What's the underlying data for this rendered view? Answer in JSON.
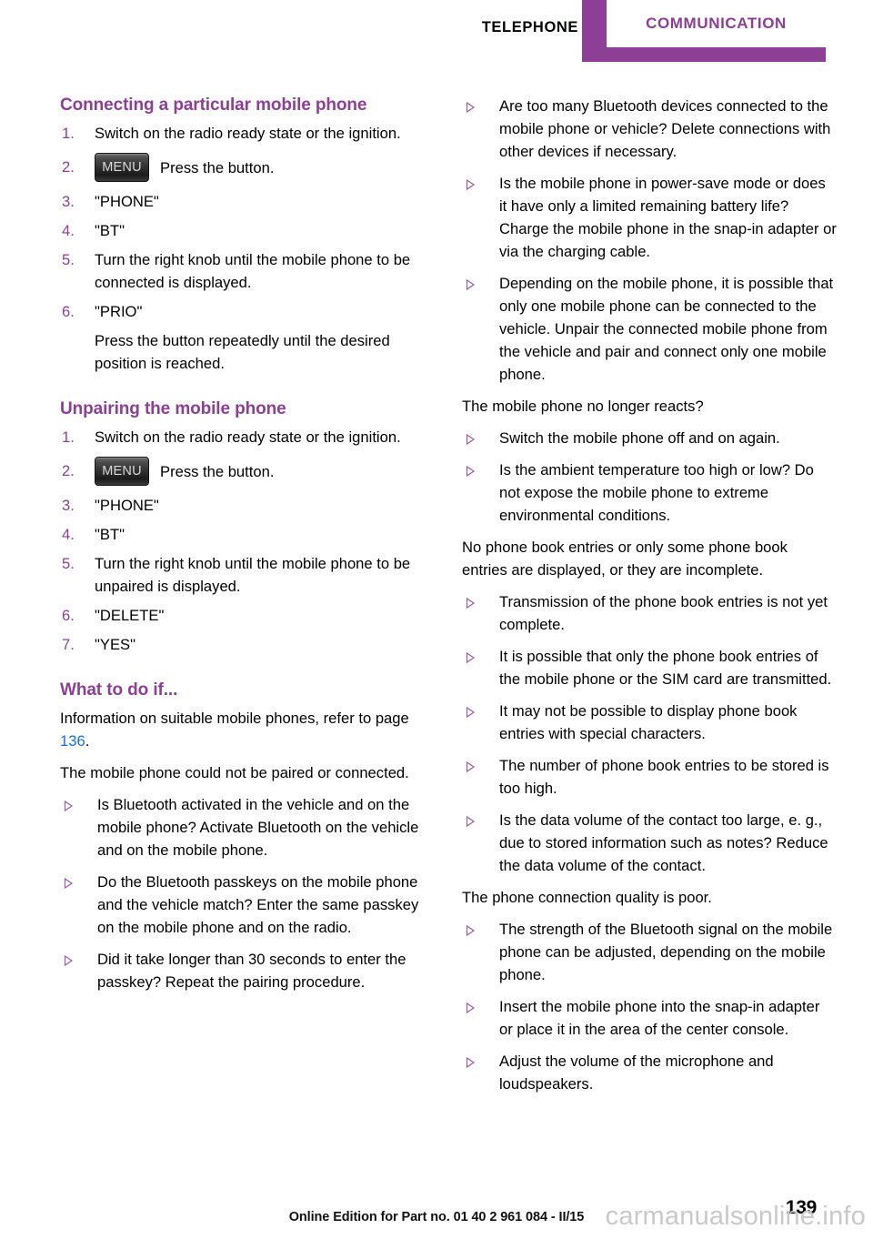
{
  "header": {
    "chapter_label": "TELEPHONE",
    "tab_label": "COMMUNICATION",
    "accent_color": "#8c3f95"
  },
  "icons": {
    "menu_key_label": "MENU",
    "bullet_icon": "triangle-right-icon"
  },
  "left_column": {
    "section1": {
      "heading": "Connecting a particular mobile phone",
      "steps": [
        {
          "num": "1.",
          "text": "Switch on the radio ready state or the ignition."
        },
        {
          "num": "2.",
          "key": "MENU",
          "text": "Press the button."
        },
        {
          "num": "3.",
          "text": "\"PHONE\""
        },
        {
          "num": "4.",
          "text": "\"BT\""
        },
        {
          "num": "5.",
          "text": "Turn the right knob until the mobile phone to be connected is displayed."
        },
        {
          "num": "6.",
          "text": "\"PRIO\""
        }
      ],
      "step6_note": "Press the button repeatedly until the desired position is reached."
    },
    "section2": {
      "heading": "Unpairing the mobile phone",
      "steps": [
        {
          "num": "1.",
          "text": "Switch on the radio ready state or the ignition."
        },
        {
          "num": "2.",
          "key": "MENU",
          "text": "Press the button."
        },
        {
          "num": "3.",
          "text": "\"PHONE\""
        },
        {
          "num": "4.",
          "text": "\"BT\""
        },
        {
          "num": "5.",
          "text": "Turn the right knob until the mobile phone to be unpaired is displayed."
        },
        {
          "num": "6.",
          "text": "\"DELETE\""
        },
        {
          "num": "7.",
          "text": "\"YES\""
        }
      ]
    },
    "section3": {
      "heading": "What to do if...",
      "intro_before_ref": "Information on suitable mobile phones, refer to page ",
      "intro_page_ref": "136",
      "intro_after_ref": ".",
      "problem1": "The mobile phone could not be paired or connected.",
      "bullets1": [
        "Is Bluetooth activated in the vehicle and on the mobile phone? Activate Bluetooth on the vehicle and on the mobile phone.",
        "Do the Bluetooth passkeys on the mobile phone and the vehicle match? Enter the same passkey on the mobile phone and on the radio.",
        "Did it take longer than 30 seconds to enter the passkey? Repeat the pairing procedure."
      ]
    }
  },
  "right_column": {
    "bullets_continued": [
      "Are too many Bluetooth devices connected to the mobile phone or vehicle? Delete connections with other devices if necessary.",
      "Is the mobile phone in power-save mode or does it have only a limited remaining battery life? Charge the mobile phone in the snap-in adapter or via the charging cable.",
      "Depending on the mobile phone, it is possible that only one mobile phone can be connected to the vehicle. Unpair the connected mobile phone from the vehicle and pair and connect only one mobile phone."
    ],
    "problem2": "The mobile phone no longer reacts?",
    "bullets2": [
      "Switch the mobile phone off and on again.",
      "Is the ambient temperature too high or low? Do not expose the mobile phone to extreme environmental conditions."
    ],
    "problem3": "No phone book entries or only some phone book entries are displayed, or they are incomplete.",
    "bullets3": [
      "Transmission of the phone book entries is not yet complete.",
      "It is possible that only the phone book entries of the mobile phone or the SIM card are transmitted.",
      "It may not be possible to display phone book entries with special characters.",
      "The number of phone book entries to be stored is too high.",
      "Is the data volume of the contact too large, e. g., due to stored information such as notes? Reduce the data volume of the contact."
    ],
    "problem4": "The phone connection quality is poor.",
    "bullets4": [
      "The strength of the Bluetooth signal on the mobile phone can be adjusted, depending on the mobile phone.",
      "Insert the mobile phone into the snap-in adapter or place it in the area of the center console.",
      "Adjust the volume of the microphone and loudspeakers."
    ]
  },
  "footer": {
    "edition_text": "Online Edition for Part no. 01 40 2 961 084 - II/15",
    "page_number": "139",
    "watermark": "carmanualsonline.info"
  }
}
